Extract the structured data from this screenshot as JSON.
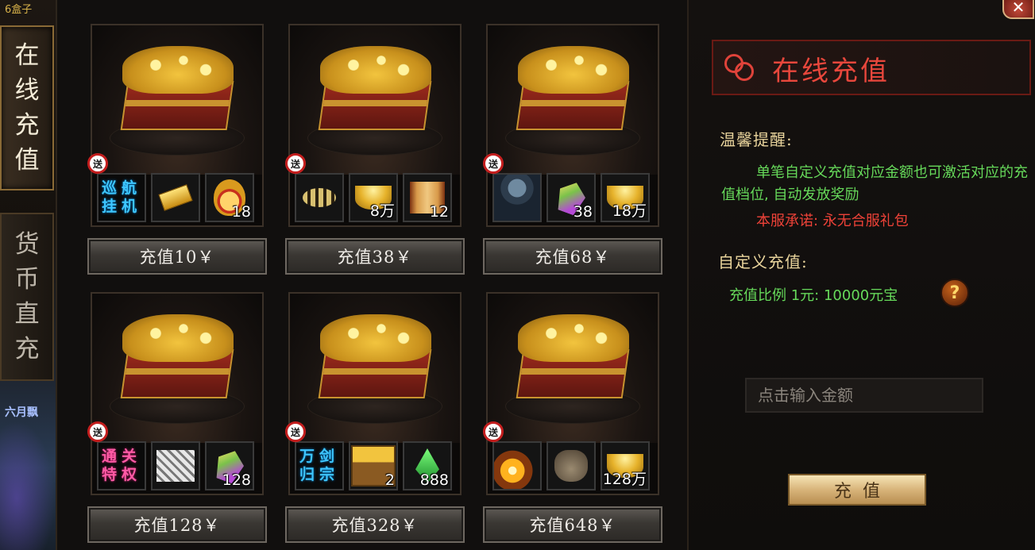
{
  "world": {
    "top_text": "6盒子",
    "mid_text": "六月飘"
  },
  "side_tabs": [
    {
      "label": [
        "在",
        "线",
        "充",
        "值"
      ]
    },
    {
      "label": [
        "货",
        "币",
        "直",
        "充"
      ]
    }
  ],
  "gift_mark": "送",
  "packages": [
    {
      "button": "充值10￥",
      "items": [
        {
          "kind": "tag",
          "text": [
            "巡航",
            "挂机"
          ],
          "style": "blue",
          "count": ""
        },
        {
          "kind": "gold-bar",
          "count": ""
        },
        {
          "kind": "medal",
          "count": "18"
        }
      ]
    },
    {
      "button": "充值38￥",
      "items": [
        {
          "kind": "bee",
          "count": ""
        },
        {
          "kind": "ingot",
          "count": "8万"
        },
        {
          "kind": "scroll",
          "count": "12"
        }
      ]
    },
    {
      "button": "充值68￥",
      "items": [
        {
          "kind": "warrior",
          "count": ""
        },
        {
          "kind": "gem",
          "count": "38"
        },
        {
          "kind": "ingot",
          "count": "18万"
        }
      ]
    },
    {
      "button": "充值128￥",
      "items": [
        {
          "kind": "tag",
          "text": [
            "通关",
            "特权"
          ],
          "style": "pink",
          "count": ""
        },
        {
          "kind": "silver",
          "count": ""
        },
        {
          "kind": "gem",
          "count": "128"
        }
      ]
    },
    {
      "button": "充值328￥",
      "items": [
        {
          "kind": "tag",
          "text": [
            "万剑",
            "归宗"
          ],
          "style": "blue",
          "count": ""
        },
        {
          "kind": "crate",
          "count": "2"
        },
        {
          "kind": "green-gem",
          "count": "888"
        }
      ]
    },
    {
      "button": "充值648￥",
      "items": [
        {
          "kind": "flame",
          "count": ""
        },
        {
          "kind": "bag",
          "count": ""
        },
        {
          "kind": "ingot",
          "count": "128万"
        }
      ]
    }
  ],
  "panel": {
    "title": "在线充值",
    "reminder_label": "温馨提醒:",
    "notice": "单笔自定义充值对应金额也可激活对应的充值档位, 自动发放奖励",
    "promise": "本服承诺: 永无合服礼包",
    "custom_label": "自定义充值:",
    "ratio": "充值比例  1元: 10000元宝",
    "help": "?",
    "amount_placeholder": "点击输入金额",
    "pay_button": "充值",
    "close": "✕"
  },
  "colors": {
    "title_red": "#e8473c",
    "notice_green": "#66d95a",
    "label_gold": "#e9d49c",
    "gift_red": "#c41e1e"
  }
}
